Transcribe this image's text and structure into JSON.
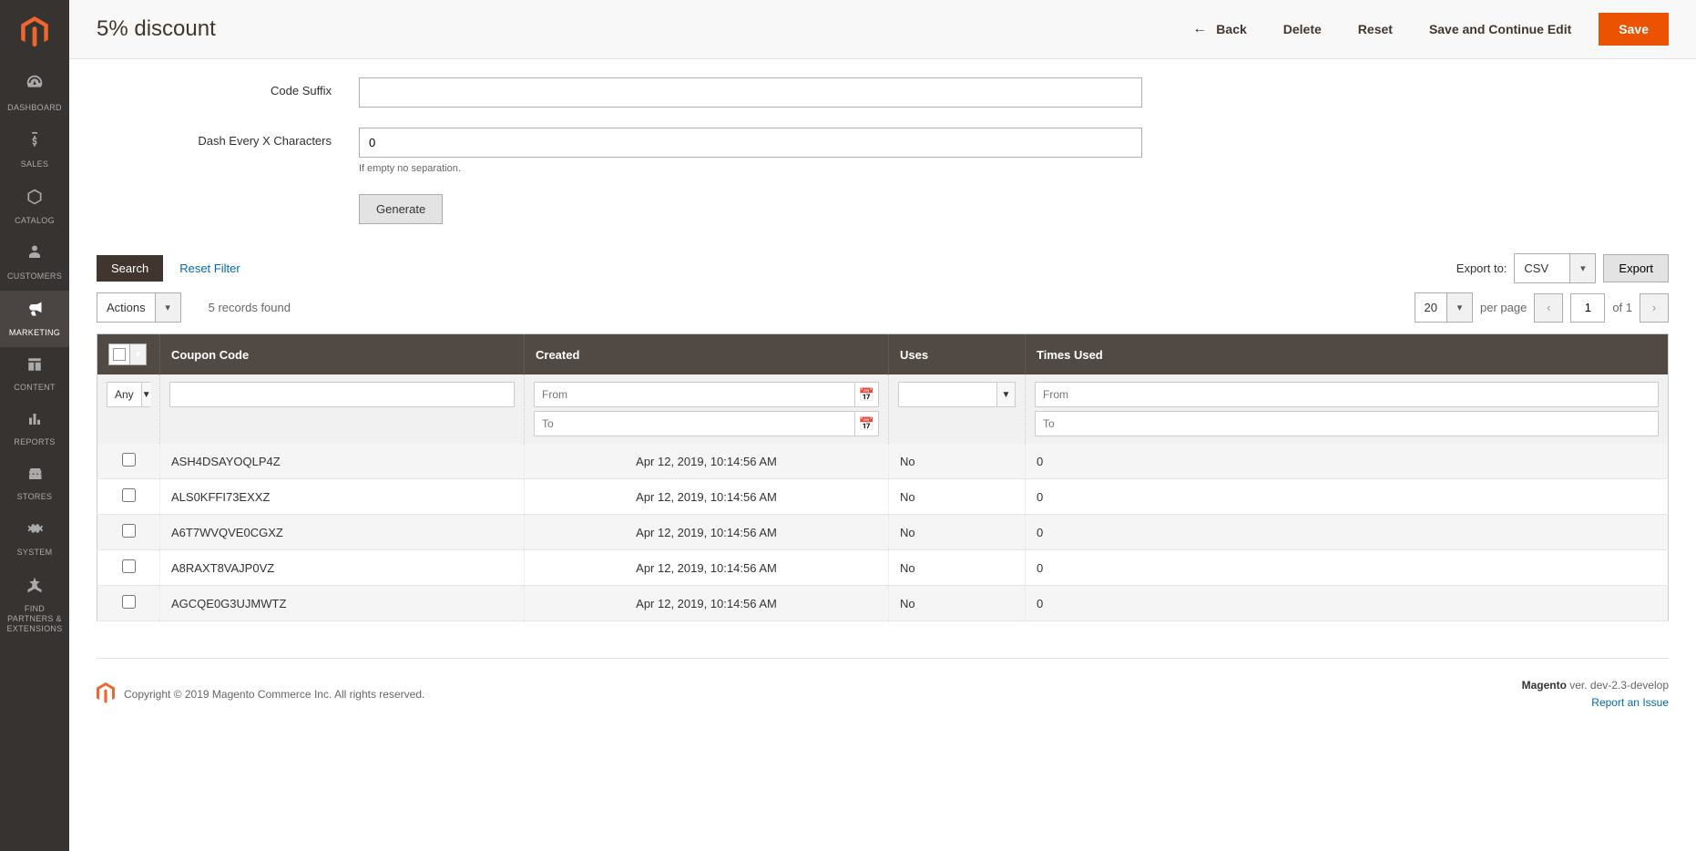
{
  "sidebar": {
    "items": [
      {
        "label": "DASHBOARD"
      },
      {
        "label": "SALES"
      },
      {
        "label": "CATALOG"
      },
      {
        "label": "CUSTOMERS"
      },
      {
        "label": "MARKETING"
      },
      {
        "label": "CONTENT"
      },
      {
        "label": "REPORTS"
      },
      {
        "label": "STORES"
      },
      {
        "label": "SYSTEM"
      },
      {
        "label": "FIND PARTNERS & EXTENSIONS"
      }
    ]
  },
  "header": {
    "title": "5% discount",
    "back": "Back",
    "delete": "Delete",
    "reset": "Reset",
    "save_continue": "Save and Continue Edit",
    "save": "Save"
  },
  "form": {
    "code_suffix_label": "Code Suffix",
    "code_suffix_value": "",
    "dash_label": "Dash Every X Characters",
    "dash_value": "0",
    "dash_note": "If empty no separation.",
    "generate": "Generate"
  },
  "grid": {
    "search": "Search",
    "reset_filter": "Reset Filter",
    "export_label": "Export to:",
    "export_format": "CSV",
    "export_btn": "Export",
    "actions": "Actions",
    "records_found": "5 records found",
    "per_page_value": "20",
    "per_page_label": "per page",
    "page_current": "1",
    "page_of": "of 1",
    "headers": {
      "coupon_code": "Coupon Code",
      "created": "Created",
      "uses": "Uses",
      "times_used": "Times Used"
    },
    "filters": {
      "any": "Any",
      "from": "From",
      "to": "To"
    },
    "rows": [
      {
        "code": "ASH4DSAYOQLP4Z",
        "created": "Apr 12, 2019, 10:14:56 AM",
        "uses": "No",
        "times": "0"
      },
      {
        "code": "ALS0KFFI73EXXZ",
        "created": "Apr 12, 2019, 10:14:56 AM",
        "uses": "No",
        "times": "0"
      },
      {
        "code": "A6T7WVQVE0CGXZ",
        "created": "Apr 12, 2019, 10:14:56 AM",
        "uses": "No",
        "times": "0"
      },
      {
        "code": "A8RAXT8VAJP0VZ",
        "created": "Apr 12, 2019, 10:14:56 AM",
        "uses": "No",
        "times": "0"
      },
      {
        "code": "AGCQE0G3UJMWTZ",
        "created": "Apr 12, 2019, 10:14:56 AM",
        "uses": "No",
        "times": "0"
      }
    ]
  },
  "footer": {
    "copyright": "Copyright © 2019 Magento Commerce Inc. All rights reserved.",
    "brand": "Magento",
    "version": " ver. dev-2.3-develop",
    "report": "Report an Issue"
  }
}
